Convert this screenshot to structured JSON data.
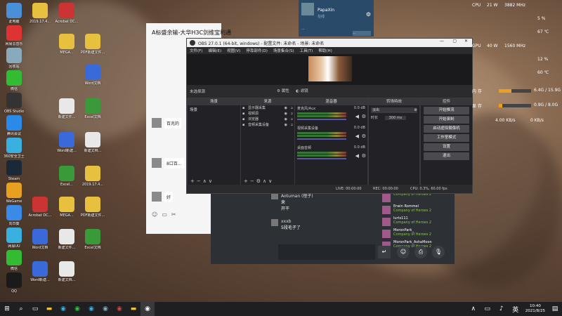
{
  "desktop": {
    "icons_col1": [
      "此电脑",
      "网易云音乐",
      "回收站",
      "微信",
      "OBS Studio",
      "腾讯会议",
      "360安全卫士",
      "Steam",
      "WeGame",
      "向日葵",
      "网易UU",
      "微信",
      "QQ"
    ],
    "icons_col2": [
      "2019.17.4...",
      "Acrobat DC...",
      "MEGA...",
      "PDF新建文件...",
      "Word文档",
      "新建文件...",
      "Excel文档",
      "Word新建...",
      "新建文档...",
      "Excel..."
    ]
  },
  "wechat": {
    "title": "A标盛余输-大华H3C剑维宝利通",
    "msg1": "百兆的",
    "msg2": "8口百...",
    "msg3": "好"
  },
  "popup": {
    "name": "PapaXin",
    "status": "在线",
    "line": "...",
    "button": "..."
  },
  "obs": {
    "title": "OBS 27.0.1 (64-bit, windows) - 配置文件: 未命名 - 场景: 未命名",
    "menu": [
      "文件(F)",
      "编辑(E)",
      "视图(V)",
      "停靠部件(D)",
      "场景集合(S)",
      "工具(T)",
      "帮助(H)"
    ],
    "source_none": "未选择源",
    "props_btn": "属性",
    "filter_btn": "滤镜",
    "docks": {
      "scenes": "场景",
      "sources": "来源",
      "mixer": "混音器",
      "transitions": "转场特效",
      "controls": "控件"
    },
    "scene_item": "场景",
    "sources": [
      "显示器采集",
      "视频源",
      "浏览器",
      "音频采集设备"
    ],
    "mixer": [
      {
        "name": "麦克风/Aux",
        "db": "0.0 dB"
      },
      {
        "name": "视频采集设备",
        "db": "0.0 dB"
      },
      {
        "name": "桌面音频",
        "db": "0.0 dB"
      }
    ],
    "transition": "淡出",
    "duration_label": "时长",
    "duration": "300 ms",
    "controls": [
      "开始推流",
      "开始录制",
      "启动虚拟摄像机",
      "工作室模式",
      "设置",
      "退出"
    ],
    "status": {
      "live": "LIVE: 00:00:00",
      "rec": "REC: 00:00:00",
      "cpu": "CPU: 0.3%, 60.00 fps"
    }
  },
  "chat": {
    "messages": [
      {
        "user": "Aotuman (橙子)",
        "text": "来"
      },
      {
        "user": "",
        "text": "开干"
      },
      {
        "user": "xxxb",
        "text": "5段毛子了"
      }
    ],
    "members": [
      {
        "name": "",
        "game": "Company of Heroes 2"
      },
      {
        "name": "Erwin Rommel",
        "game": "Company of Heroes 2"
      },
      {
        "name": "lurts111",
        "game": "Company of Heroes 2"
      },
      {
        "name": "MoronPark_",
        "game": "Company of Heroes 2"
      },
      {
        "name": "MoronPark_AshaMoon",
        "game": "Company of Heroes 2"
      }
    ]
  },
  "monitor": {
    "cpu": "CPU",
    "cpu_w": "21 W",
    "cpu_mhz": "3882 MHz",
    "cpu_pct": "5 %",
    "cpu_temp": "67 ℃",
    "gpu": "GPU",
    "gpu_w": "40 W",
    "gpu_mhz": "1560 MHz",
    "gpu_pct": "12 %",
    "gpu_temp": "60 ℃",
    "mem_label": "内 存",
    "mem": "6.4G / 15.9G",
    "vram_label": "显 存",
    "vram": "0.9G / 8.0G",
    "net_up": "4.00 KB/s",
    "net_down": "0 KB/s"
  },
  "taskbar": {
    "time": "10:40",
    "date": "2021/8/25",
    "ime": "英"
  }
}
